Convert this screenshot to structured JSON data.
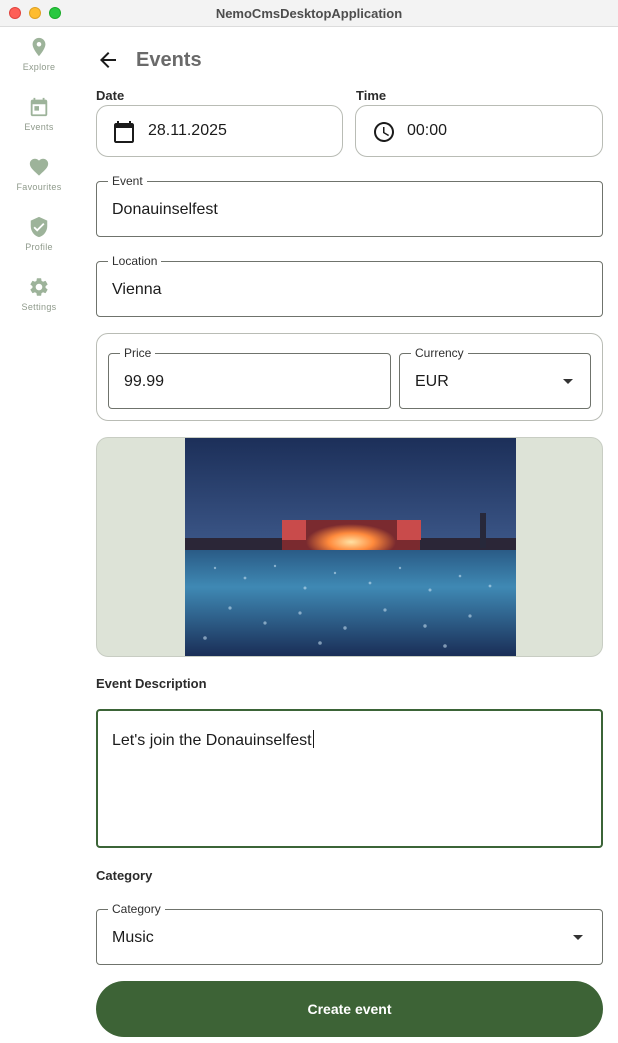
{
  "window": {
    "title": "NemoCmsDesktopApplication"
  },
  "sidebar": {
    "items": [
      {
        "label": "Explore",
        "icon": "location-pin-icon"
      },
      {
        "label": "Events",
        "icon": "calendar-icon"
      },
      {
        "label": "Favourites",
        "icon": "heart-icon"
      },
      {
        "label": "Profile",
        "icon": "shield-check-icon"
      },
      {
        "label": "Settings",
        "icon": "gear-icon"
      }
    ]
  },
  "header": {
    "title": "Events"
  },
  "form": {
    "date": {
      "label": "Date",
      "value": "28.11.2025"
    },
    "time": {
      "label": "Time",
      "value": "00:00"
    },
    "event": {
      "label": "Event",
      "value": "Donauinselfest"
    },
    "location": {
      "label": "Location",
      "value": "Vienna"
    },
    "price": {
      "label": "Price",
      "value": "99.99"
    },
    "currency": {
      "label": "Currency",
      "value": "EUR"
    },
    "description": {
      "heading": "Event Description",
      "value": "Let's join the Donauinselfest"
    },
    "category": {
      "heading": "Category",
      "label": "Category",
      "value": "Music"
    },
    "submit_label": "Create event"
  },
  "colors": {
    "accent": "#3d6336",
    "sidebar_icon": "#9db39a",
    "field_border": "#6f736c",
    "image_bg": "#dde3d7"
  }
}
